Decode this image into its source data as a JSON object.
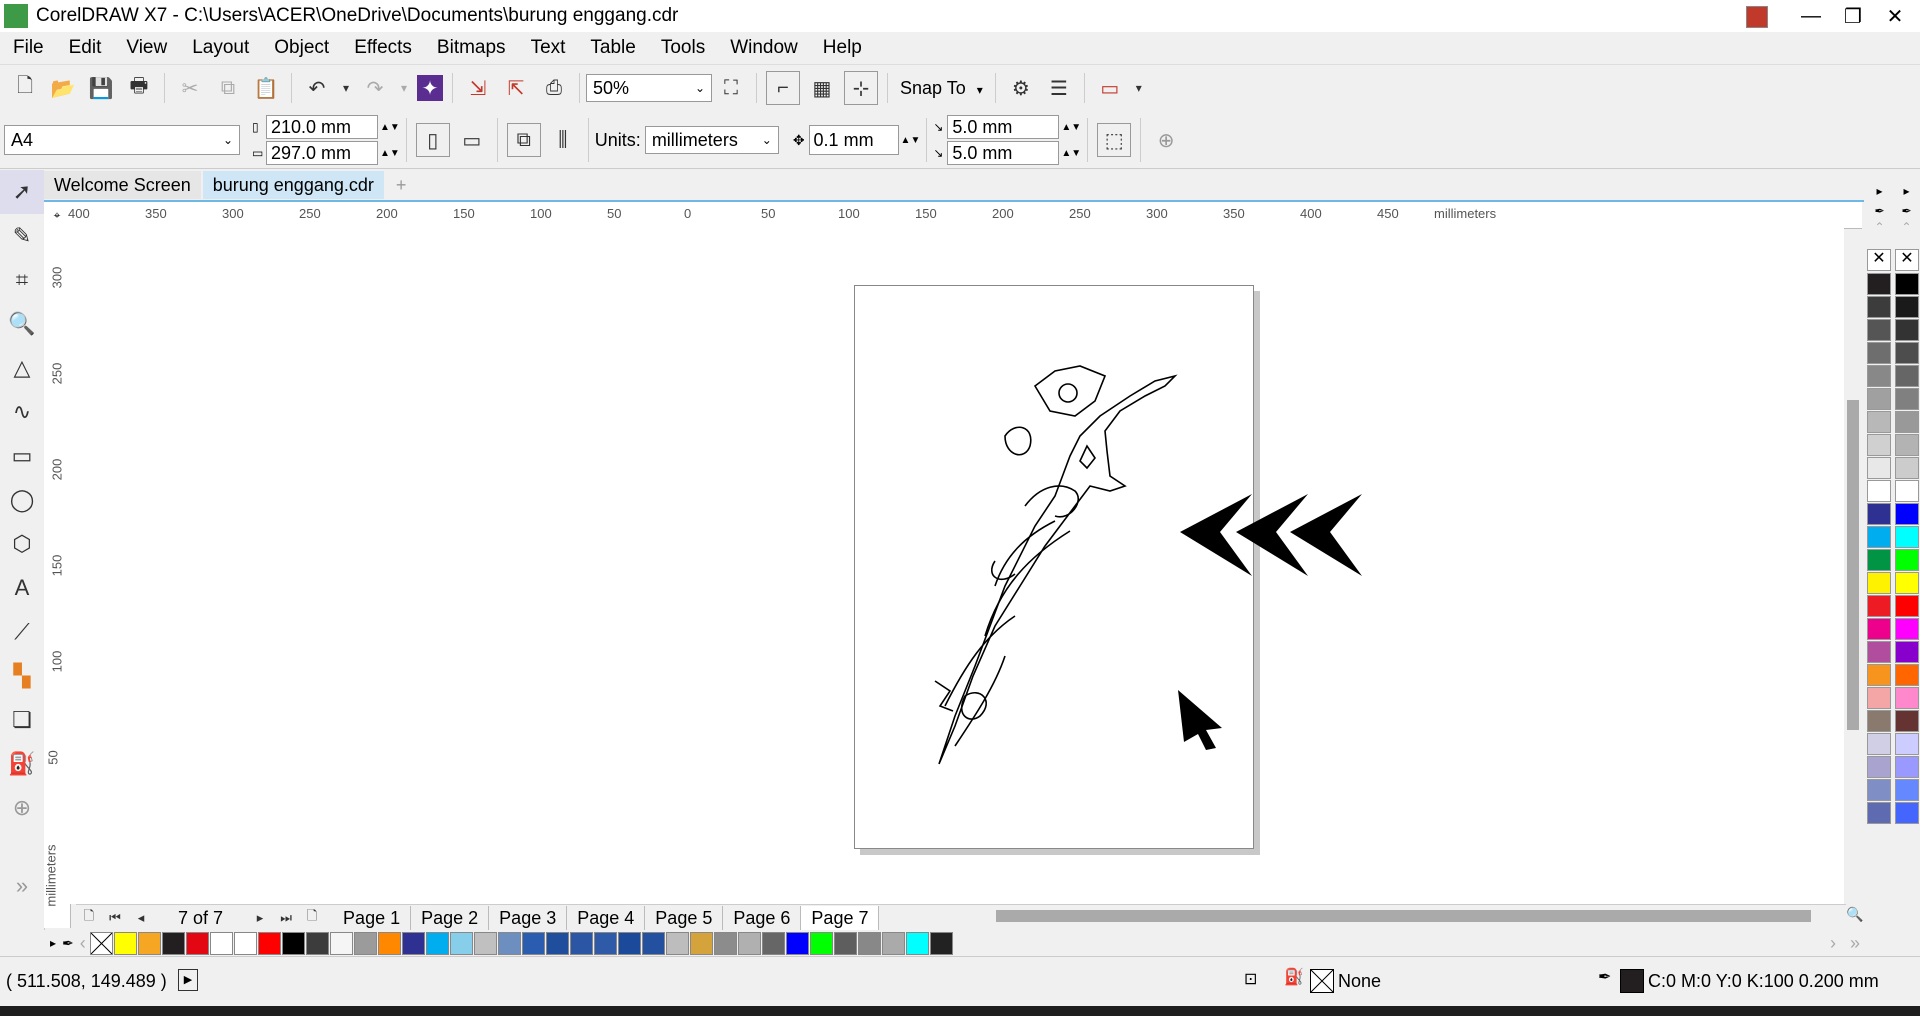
{
  "window": {
    "title": "CorelDRAW X7 - C:\\Users\\ACER\\OneDrive\\Documents\\burung enggang.cdr"
  },
  "menu": [
    "File",
    "Edit",
    "View",
    "Layout",
    "Object",
    "Effects",
    "Bitmaps",
    "Text",
    "Table",
    "Tools",
    "Window",
    "Help"
  ],
  "toolbar": {
    "zoom_value": "50%",
    "snap_label": "Snap To"
  },
  "propbar": {
    "page_size": "A4",
    "width": "210.0 mm",
    "height": "297.0 mm",
    "units_label": "Units:",
    "units_value": "millimeters",
    "nudge": "0.1 mm",
    "dup_x": "5.0 mm",
    "dup_y": "5.0 mm"
  },
  "tabs": [
    "Welcome Screen",
    "burung enggang.cdr"
  ],
  "ruler": {
    "h_ticks": [
      "400",
      "350",
      "300",
      "250",
      "200",
      "150",
      "100",
      "50",
      "0",
      "50",
      "100",
      "150",
      "200",
      "250",
      "300",
      "350",
      "400",
      "450"
    ],
    "h_unit": "millimeters",
    "v_ticks": [
      "300",
      "250",
      "200",
      "150",
      "100",
      "50"
    ],
    "v_unit": "millimeters"
  },
  "pages": {
    "counter": "7 of 7",
    "items": [
      "Page 1",
      "Page 2",
      "Page 3",
      "Page 4",
      "Page 5",
      "Page 6",
      "Page 7"
    ],
    "active": "Page 7"
  },
  "palette_colors": [
    "#ffff00",
    "#f5a623",
    "#231f20",
    "#e30613",
    "#ffffff",
    "#ffffff",
    "#ff0000",
    "#000000",
    "#3c3c3c",
    "#f5f5f5",
    "#9b9b9b",
    "#ff8800",
    "#2e3192",
    "#00aeef",
    "#87ceeb",
    "#c0c0c0",
    "#6d8fbf",
    "#2a5db0",
    "#1f4e9c",
    "#2b56a3",
    "#2e5aa8",
    "#1c4a9a",
    "#2450a0",
    "#bdbdbd",
    "#d4a33b",
    "#8c8c8c",
    "#b0b0b0",
    "#666666",
    "#0000ff",
    "#00ff00",
    "#5e5e5e",
    "#888888",
    "#aaaaaa",
    "#00ffff",
    "#222222"
  ],
  "right_palette": {
    "col1": [
      "#231f20",
      "#3c3c3c",
      "#555555",
      "#6e6e6e",
      "#888888",
      "#a0a0a0",
      "#b8b8b8",
      "#d0d0d0",
      "#e8e8e8",
      "#ffffff",
      "#2e3192",
      "#00aeef",
      "#009444",
      "#fff200",
      "#ed1c24",
      "#ec008c",
      "#b04e9d",
      "#f7941d",
      "#f4a6a6",
      "#8a7a6e",
      "#d1cfe6",
      "#a9a3d0",
      "#7f8ec4",
      "#5f6bb0"
    ],
    "col2": [
      "#000000",
      "#1a1a1a",
      "#333333",
      "#4d4d4d",
      "#666666",
      "#808080",
      "#999999",
      "#b3b3b3",
      "#cccccc",
      "#ffffff",
      "#0000ff",
      "#00ffff",
      "#00ff00",
      "#ffff00",
      "#ff0000",
      "#ff00ff",
      "#8800cc",
      "#ff6600",
      "#ff88cc",
      "#663333",
      "#ccccff",
      "#9999ff",
      "#6688ff",
      "#4466ff"
    ]
  },
  "status": {
    "coords": "( 511.508, 149.489 )",
    "fill_label": "None",
    "outline_label": "C:0 M:0 Y:0 K:100  0.200 mm"
  }
}
